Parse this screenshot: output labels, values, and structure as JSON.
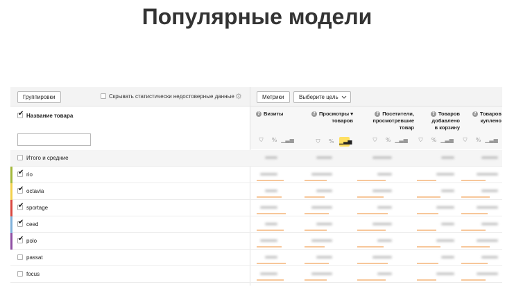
{
  "slide": {
    "title": "Популярные модели"
  },
  "toolbar": {
    "groupings_label": "Группировки",
    "hide_unreliable_label": "Скрывать статистически недостоверные данные",
    "metrics_label": "Метрики",
    "goal_select_label": "Выберите цель"
  },
  "table": {
    "name_column": "Название товара",
    "filter_placeholder": "",
    "metrics": [
      {
        "lines": [
          "Визиты"
        ],
        "help_icon": "question-icon"
      },
      {
        "lines": [
          "Просмотры ▾",
          "товаров"
        ],
        "help_icon": "question-icon"
      },
      {
        "lines": [
          "Посетители,",
          "просмотревшие",
          "товар"
        ],
        "help_icon": "question-icon"
      },
      {
        "lines": [
          "Товаров",
          "добавлено",
          "в корзину"
        ],
        "help_icon": "question-icon"
      },
      {
        "lines": [
          "Товаров",
          "куплено"
        ],
        "help_icon": "question-icon"
      }
    ],
    "column_icons": [
      "filter-icon",
      "percent-icon",
      "bar-chart-icon"
    ],
    "total_row": {
      "label": "Итого и средние",
      "checked": false
    },
    "rows": [
      {
        "label": "rio",
        "checked": true,
        "color": "#a3b83a"
      },
      {
        "label": "octavia",
        "checked": true,
        "color": "#f2d04b"
      },
      {
        "label": "sportage",
        "checked": true,
        "color": "#d9473f"
      },
      {
        "label": "ceed",
        "checked": true,
        "color": "#7fb0d9"
      },
      {
        "label": "polo",
        "checked": true,
        "color": "#8e4fa3"
      },
      {
        "label": "passat",
        "checked": false,
        "color": ""
      },
      {
        "label": "focus",
        "checked": false,
        "color": ""
      }
    ]
  },
  "colors": {
    "accent": "#ffe063",
    "bar": "#f7c79a"
  }
}
